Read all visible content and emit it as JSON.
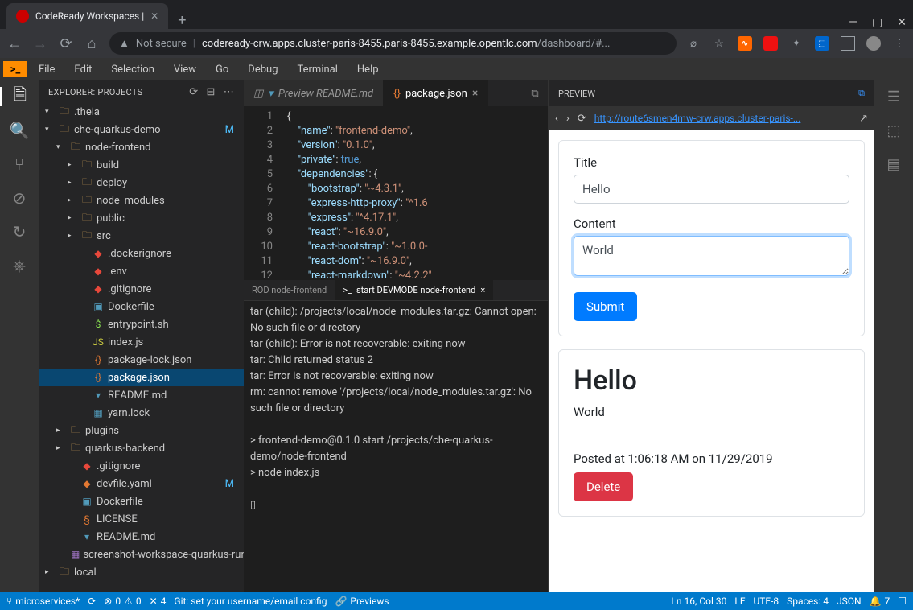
{
  "browser": {
    "tab_title": "CodeReady Workspaces |",
    "url_host": "codeready-crw.apps.cluster-paris-8455.paris-8455.example.opentlc.com",
    "url_path": "/dashboard/#...",
    "not_secure": "Not secure"
  },
  "menubar": [
    "File",
    "Edit",
    "Selection",
    "View",
    "Go",
    "Debug",
    "Terminal",
    "Help"
  ],
  "sidebar": {
    "title": "EXPLORER: PROJECTS",
    "tree": [
      {
        "d": 0,
        "t": "folder",
        "e": true,
        "n": ".theia"
      },
      {
        "d": 0,
        "t": "folder",
        "e": true,
        "n": "che-quarkus-demo",
        "m": "M"
      },
      {
        "d": 1,
        "t": "folder",
        "e": true,
        "n": "node-frontend"
      },
      {
        "d": 2,
        "t": "folder",
        "e": false,
        "n": "build"
      },
      {
        "d": 2,
        "t": "folder",
        "e": false,
        "n": "deploy"
      },
      {
        "d": 2,
        "t": "folder",
        "e": false,
        "n": "node_modules"
      },
      {
        "d": 2,
        "t": "folder",
        "e": false,
        "n": "public"
      },
      {
        "d": 2,
        "t": "folder",
        "e": false,
        "n": "src"
      },
      {
        "d": 3,
        "t": "git",
        "n": ".dockerignore"
      },
      {
        "d": 3,
        "t": "env",
        "n": ".env"
      },
      {
        "d": 3,
        "t": "git",
        "n": ".gitignore"
      },
      {
        "d": 3,
        "t": "docker",
        "n": "Dockerfile"
      },
      {
        "d": 3,
        "t": "sh",
        "n": "entrypoint.sh"
      },
      {
        "d": 3,
        "t": "js",
        "n": "index.js"
      },
      {
        "d": 3,
        "t": "json",
        "n": "package-lock.json"
      },
      {
        "d": 3,
        "t": "json",
        "n": "package.json",
        "sel": true
      },
      {
        "d": 3,
        "t": "md",
        "n": "README.md"
      },
      {
        "d": 3,
        "t": "lock",
        "n": "yarn.lock"
      },
      {
        "d": 1,
        "t": "folder",
        "e": false,
        "n": "plugins"
      },
      {
        "d": 1,
        "t": "folder",
        "e": false,
        "n": "quarkus-backend"
      },
      {
        "d": 2,
        "t": "git",
        "n": ".gitignore"
      },
      {
        "d": 2,
        "t": "yaml",
        "n": "devfile.yaml",
        "m": "M"
      },
      {
        "d": 2,
        "t": "docker",
        "n": "Dockerfile"
      },
      {
        "d": 2,
        "t": "lic",
        "n": "LICENSE"
      },
      {
        "d": 2,
        "t": "md",
        "n": "README.md"
      },
      {
        "d": 2,
        "t": "img",
        "n": "screenshot-workspace-quarkus-run"
      },
      {
        "d": 0,
        "t": "folder",
        "e": false,
        "n": "local"
      }
    ]
  },
  "editor_tabs": [
    {
      "label": "Preview README.md",
      "active": false,
      "icon": "md"
    },
    {
      "label": "package.json",
      "active": true,
      "icon": "json",
      "close": true
    }
  ],
  "gutter": [
    "1",
    "2",
    "3",
    "4",
    "5",
    "6",
    "7",
    "8",
    "9",
    "10",
    "11",
    "12"
  ],
  "code_lines": [
    [
      [
        "brace",
        "{"
      ]
    ],
    [
      [
        "punc",
        "    "
      ],
      [
        "key",
        "\"name\""
      ],
      [
        "punc",
        ": "
      ],
      [
        "str",
        "\"frontend-demo\""
      ],
      [
        "punc",
        ","
      ]
    ],
    [
      [
        "punc",
        "    "
      ],
      [
        "key",
        "\"version\""
      ],
      [
        "punc",
        ": "
      ],
      [
        "str",
        "\"0.1.0\""
      ],
      [
        "punc",
        ","
      ]
    ],
    [
      [
        "punc",
        "    "
      ],
      [
        "key",
        "\"private\""
      ],
      [
        "punc",
        ": "
      ],
      [
        "bool",
        "true"
      ],
      [
        "punc",
        ","
      ]
    ],
    [
      [
        "punc",
        "    "
      ],
      [
        "key",
        "\"dependencies\""
      ],
      [
        "punc",
        ": {"
      ]
    ],
    [
      [
        "punc",
        "        "
      ],
      [
        "key",
        "\"bootstrap\""
      ],
      [
        "punc",
        ": "
      ],
      [
        "str",
        "\"~4.3.1\""
      ],
      [
        "punc",
        ","
      ]
    ],
    [
      [
        "punc",
        "        "
      ],
      [
        "key",
        "\"express-http-proxy\""
      ],
      [
        "punc",
        ": "
      ],
      [
        "str",
        "\"^1.6"
      ]
    ],
    [
      [
        "punc",
        "        "
      ],
      [
        "key",
        "\"express\""
      ],
      [
        "punc",
        ": "
      ],
      [
        "str",
        "\"^4.17.1\""
      ],
      [
        "punc",
        ","
      ]
    ],
    [
      [
        "punc",
        "        "
      ],
      [
        "key",
        "\"react\""
      ],
      [
        "punc",
        ": "
      ],
      [
        "str",
        "\"~16.9.0\""
      ],
      [
        "punc",
        ","
      ]
    ],
    [
      [
        "punc",
        "        "
      ],
      [
        "key",
        "\"react-bootstrap\""
      ],
      [
        "punc",
        ": "
      ],
      [
        "str",
        "\"~1.0.0-"
      ]
    ],
    [
      [
        "punc",
        "        "
      ],
      [
        "key",
        "\"react-dom\""
      ],
      [
        "punc",
        ": "
      ],
      [
        "str",
        "\"~16.9.0\""
      ],
      [
        "punc",
        ","
      ]
    ],
    [
      [
        "punc",
        "        "
      ],
      [
        "key",
        "\"react-markdown\""
      ],
      [
        "punc",
        ": "
      ],
      [
        "str",
        "\"~4.2.2\""
      ]
    ]
  ],
  "terminal": {
    "tabs": [
      {
        "label": "ROD node-frontend",
        "active": false
      },
      {
        "label": "start DEVMODE node-frontend",
        "active": true,
        "prefix": ">_",
        "close": true
      }
    ],
    "output": "tar (child): /projects/local/node_modules.tar.gz: Cannot open: No such file or directory\ntar (child): Error is not recoverable: exiting now\ntar: Child returned status 2\ntar: Error is not recoverable: exiting now\nrm: cannot remove '/projects/local/node_modules.tar.gz': No such file or directory\n\n> frontend-demo@0.1.0 start /projects/che-quarkus-demo/node-frontend\n> node index.js\n\n▯"
  },
  "preview": {
    "title": "PREVIEW",
    "url": "http://route6smen4mw-crw.apps.cluster-paris-...",
    "form": {
      "title_label": "Title",
      "title_value": "Hello",
      "content_label": "Content",
      "content_value": "World",
      "submit": "Submit"
    },
    "post": {
      "title": "Hello",
      "content": "World",
      "meta": "Posted at 1:06:18 AM on 11/29/2019",
      "delete": "Delete"
    }
  },
  "statusbar": {
    "branch": "microservices*",
    "errors": "0",
    "warnings": "0",
    "forks": "4",
    "git_msg": "Git: set your username/email config",
    "previews": "Previews",
    "pos": "Ln 16, Col 30",
    "eol": "LF",
    "enc": "UTF-8",
    "spaces": "Spaces: 4",
    "lang": "JSON",
    "bell": "7"
  }
}
